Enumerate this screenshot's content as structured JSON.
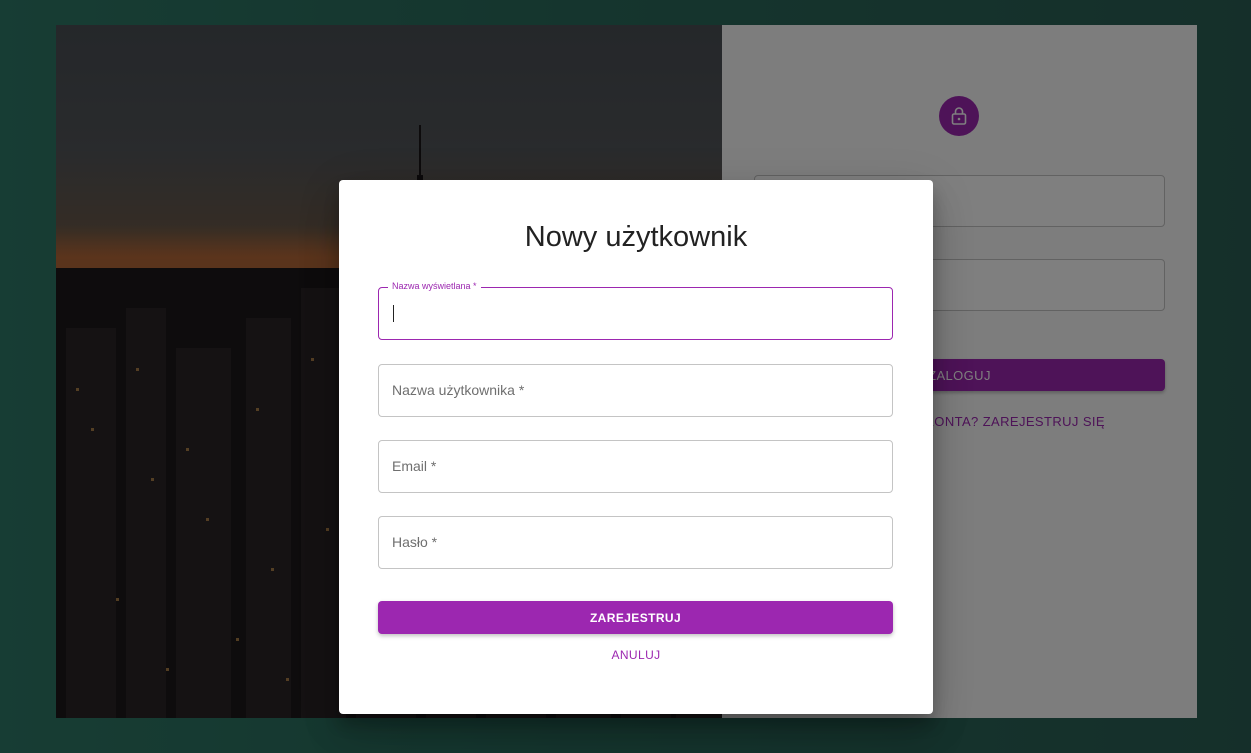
{
  "login": {
    "submit_label": "ZALOGUJ",
    "register_link": "NIE MASZ KONTA? ZAREJESTRUJ SIĘ"
  },
  "dialog": {
    "title": "Nowy użytkownik",
    "fields": [
      {
        "label": "Nazwa wyświetlana *",
        "value": ""
      },
      {
        "label": "Nazwa użytkownika *",
        "value": ""
      },
      {
        "label": "Email *",
        "value": ""
      },
      {
        "label": "Hasło *",
        "value": ""
      }
    ],
    "submit_label": "ZAREJESTRUJ",
    "cancel_label": "ANULUJ"
  },
  "colors": {
    "accent": "#9c27b0",
    "background": "#2c6d60"
  },
  "icons": {
    "avatar": "lock-icon"
  }
}
